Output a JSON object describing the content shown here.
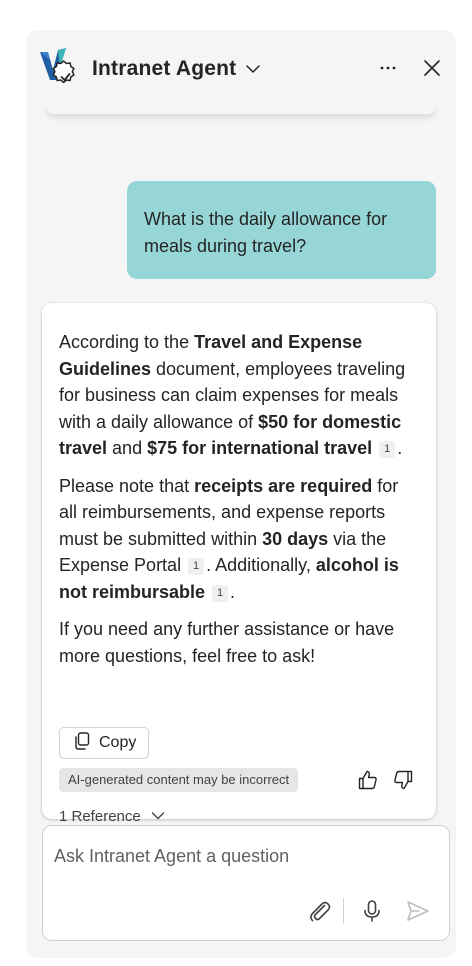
{
  "header": {
    "title": "Intranet Agent"
  },
  "conversation": {
    "user_message": "What is the daily allowance for meals during travel?",
    "response": {
      "p1": {
        "t1": "According to the ",
        "b1": "Travel and Expense Guidelines",
        "t2": " document, employees traveling for business can claim expenses for meals with a daily allowance of ",
        "b2": "$50 for domestic travel",
        "t3": " and ",
        "b3": "$75 for international travel",
        "cite": "1",
        "t4": "."
      },
      "p2": {
        "t1": "Please note that ",
        "b1": "receipts are required",
        "t2": " for all reimbursements, and expense reports must be submitted within ",
        "b2": "30 days",
        "t3": " via the Expense Portal",
        "cite1": "1",
        "t4": ". Additionally, ",
        "b3": "alcohol is not reimbursable",
        "cite2": "1",
        "t5": "."
      },
      "p3": "If you need any further assistance or have more questions, feel free to ask!",
      "copy_label": "Copy",
      "ai_disclaimer": "AI-generated content may be incorrect",
      "references_label": "1 Reference"
    }
  },
  "composer": {
    "placeholder": "Ask Intranet Agent a question"
  },
  "colors": {
    "user_bubble": "#96d6d6",
    "panel_bg": "#f5f5f5",
    "logo_blue": "#1f5fa8",
    "logo_teal": "#3fb5b5"
  }
}
